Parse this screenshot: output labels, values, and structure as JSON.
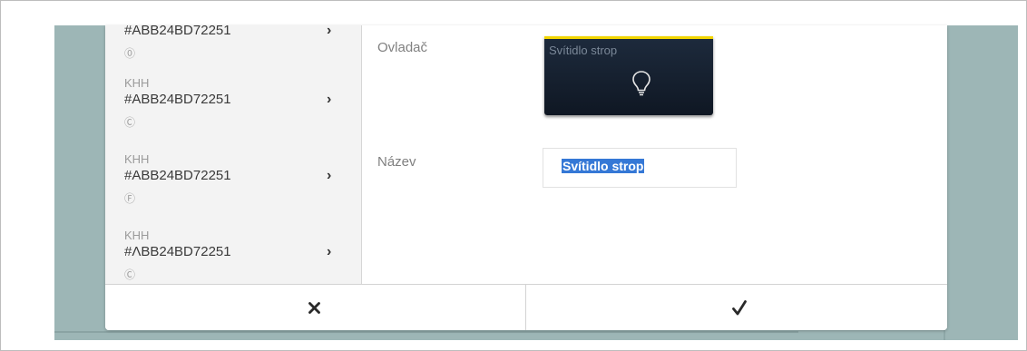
{
  "list": {
    "items": [
      {
        "type": "",
        "id": "#ABB24BD72251",
        "mark": "⓪"
      },
      {
        "type": "KHH",
        "id": "#ABB24BD72251",
        "mark": "Ⓒ"
      },
      {
        "type": "KHH",
        "id": "#ABB24BD72251",
        "mark": "Ⓕ"
      },
      {
        "type": "KHH",
        "id": "#ΛBB24BD72251",
        "mark": "Ⓒ"
      }
    ]
  },
  "form": {
    "control_label": "Ovladač",
    "tile_title": "Svítidlo strop",
    "name_label": "Název",
    "name_value": "Svítidlo strop"
  },
  "footer": {
    "cancel_icon": "close-icon",
    "confirm_icon": "check-icon"
  },
  "colors": {
    "background_teal": "#9db6b6",
    "tile_dark": "#1d2a3c",
    "tile_accent": "#f2d500",
    "selection": "#3578d6"
  }
}
